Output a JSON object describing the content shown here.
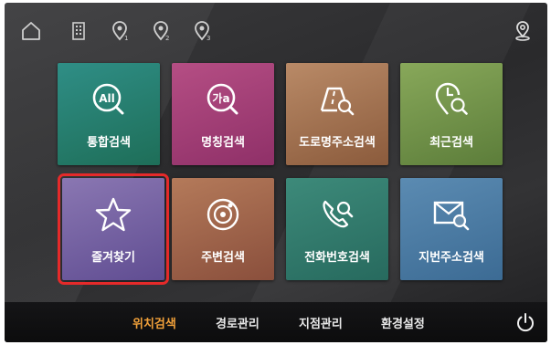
{
  "colors": {
    "accent_active": "#f2a13a",
    "selection_outline": "#e52a2a"
  },
  "topbar": {
    "icons": [
      "home-icon",
      "building-icon",
      "location-pin-1-icon",
      "location-pin-2-icon",
      "location-pin-3-icon"
    ],
    "right_icon": "user-location-icon"
  },
  "tiles": [
    {
      "label": "통합검색",
      "icon_text": "All",
      "color_top": "#2f8e86",
      "color_bottom": "#1e6e58"
    },
    {
      "label": "명칭검색",
      "icon_text": "가a",
      "color_top": "#b54e84",
      "color_bottom": "#8f3068"
    },
    {
      "label": "도로명주소검색",
      "icon_text": "",
      "color_top": "#b98a67",
      "color_bottom": "#8b5b3c"
    },
    {
      "label": "최근검색",
      "icon_text": "",
      "color_top": "#88a85a",
      "color_bottom": "#5c7d3a"
    },
    {
      "label": "즐겨찾기",
      "icon_text": "",
      "color_top": "#8a77b2",
      "color_bottom": "#604d92"
    },
    {
      "label": "주변검색",
      "icon_text": "",
      "color_top": "#b47a5a",
      "color_bottom": "#8a4f3c"
    },
    {
      "label": "전화번호검색",
      "icon_text": "",
      "color_top": "#3d8a7a",
      "color_bottom": "#276a5e"
    },
    {
      "label": "지번주소검색",
      "icon_text": "",
      "color_top": "#5b8bb2",
      "color_bottom": "#3c6b94"
    }
  ],
  "bottombar": {
    "menu": [
      "위치검색",
      "경로관리",
      "지점관리",
      "환경설정"
    ],
    "active_index": 0
  }
}
